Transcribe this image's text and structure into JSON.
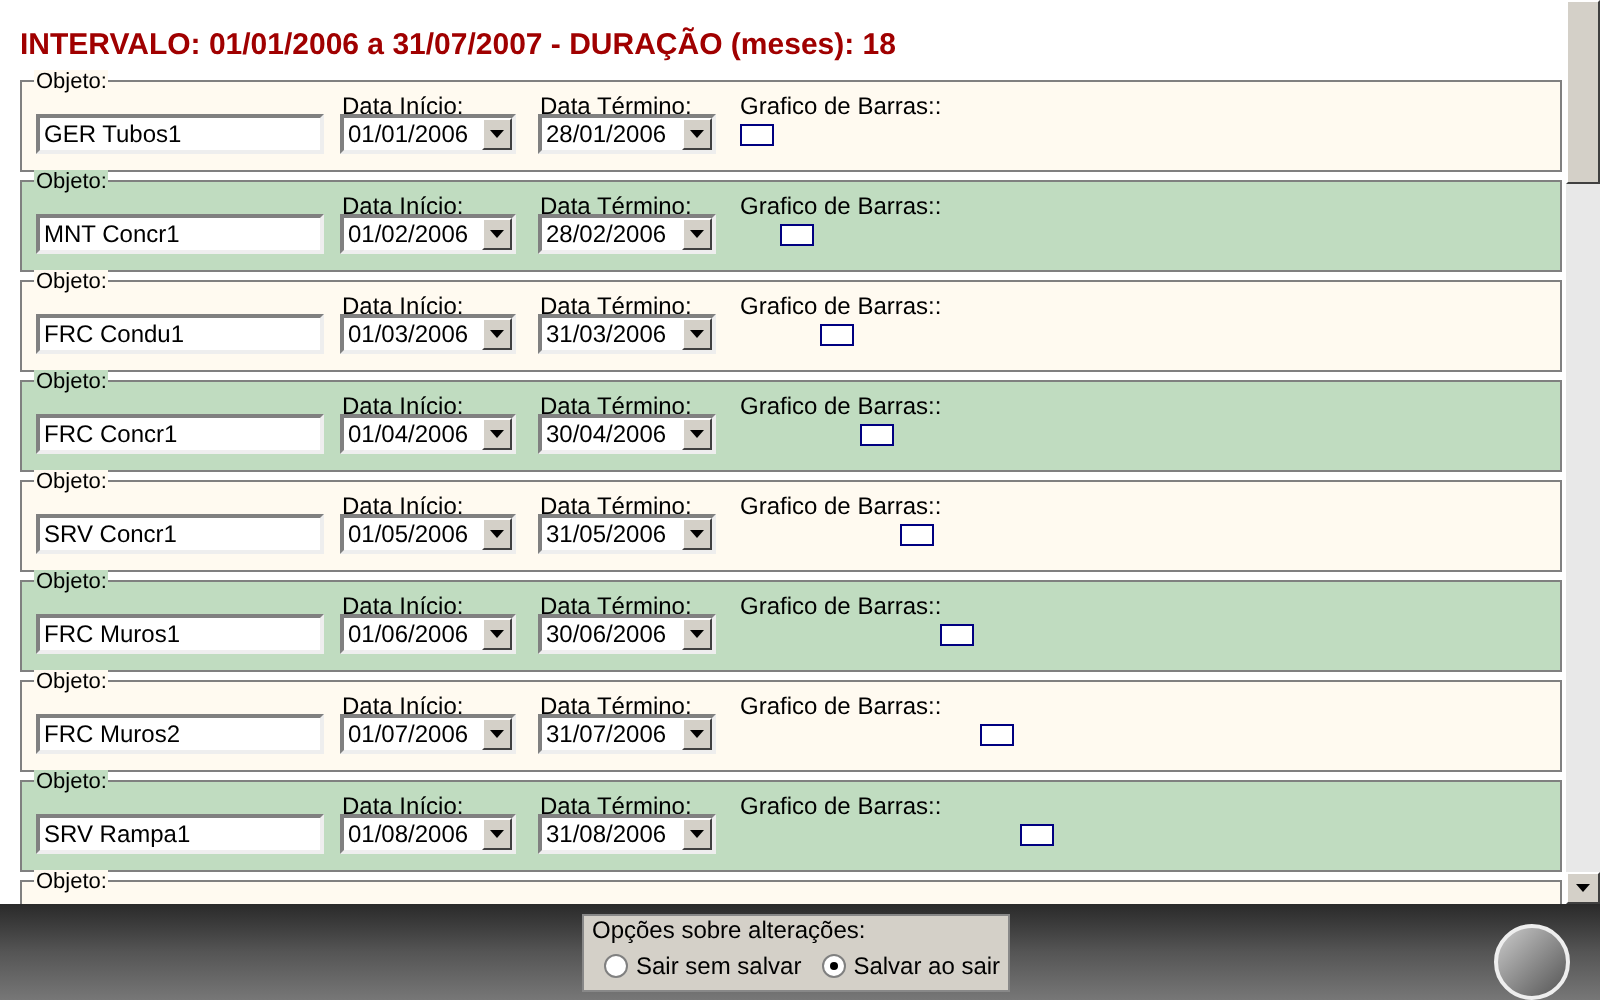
{
  "title": "INTERVALO: 01/01/2006 a 31/07/2007 - DURAÇÃO (meses): 18",
  "rows": [
    {
      "object_label": "Objeto:",
      "object": "GER Tubos1",
      "start_label": "Data Início:",
      "start": "01/01/2006",
      "end_label": "Data Término:",
      "end": "28/01/2006",
      "chart_label": "Grafico de Barras::"
    },
    {
      "object_label": "Objeto:",
      "object": "MNT Concr1",
      "start_label": "Data Início:",
      "start": "01/02/2006",
      "end_label": "Data Término:",
      "end": "28/02/2006",
      "chart_label": "Grafico de Barras::"
    },
    {
      "object_label": "Objeto:",
      "object": "FRC Condu1",
      "start_label": "Data Início:",
      "start": "01/03/2006",
      "end_label": "Data Término:",
      "end": "31/03/2006",
      "chart_label": "Grafico de Barras::"
    },
    {
      "object_label": "Objeto:",
      "object": "FRC Concr1",
      "start_label": "Data Início:",
      "start": "01/04/2006",
      "end_label": "Data Término:",
      "end": "30/04/2006",
      "chart_label": "Grafico de Barras::"
    },
    {
      "object_label": "Objeto:",
      "object": "SRV Concr1",
      "start_label": "Data Início:",
      "start": "01/05/2006",
      "end_label": "Data Término:",
      "end": "31/05/2006",
      "chart_label": "Grafico de Barras::"
    },
    {
      "object_label": "Objeto:",
      "object": "FRC Muros1",
      "start_label": "Data Início:",
      "start": "01/06/2006",
      "end_label": "Data Término:",
      "end": "30/06/2006",
      "chart_label": "Grafico de Barras::"
    },
    {
      "object_label": "Objeto:",
      "object": "FRC Muros2",
      "start_label": "Data Início:",
      "start": "01/07/2006",
      "end_label": "Data Término:",
      "end": "31/07/2006",
      "chart_label": "Grafico de Barras::"
    },
    {
      "object_label": "Objeto:",
      "object": "SRV Rampa1",
      "start_label": "Data Início:",
      "start": "01/08/2006",
      "end_label": "Data Término:",
      "end": "31/08/2006",
      "chart_label": "Grafico de Barras::"
    },
    {
      "object_label": "Objeto:"
    }
  ],
  "options": {
    "title": "Opções sobre alterações:",
    "items": [
      {
        "label": "Sair sem salvar",
        "selected": false
      },
      {
        "label": "Salvar ao sair",
        "selected": true
      }
    ]
  }
}
